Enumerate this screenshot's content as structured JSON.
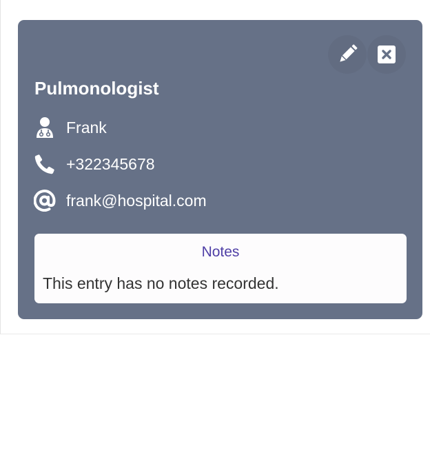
{
  "card": {
    "title": "Pulmonologist",
    "background_color": "#667187",
    "actions": [
      {
        "name": "edit",
        "icon": "pencil-icon"
      },
      {
        "name": "close",
        "icon": "close-box-icon"
      }
    ],
    "doctor": {
      "icon": "doctor-icon",
      "name": "Frank"
    },
    "phone": {
      "icon": "phone-icon",
      "number": "+322345678"
    },
    "email": {
      "icon": "at-sign-icon",
      "address": "frank@hospital.com"
    }
  },
  "notes": {
    "title": "Notes",
    "body": "This entry has no notes recorded.",
    "title_color": "#4f3fa6"
  }
}
